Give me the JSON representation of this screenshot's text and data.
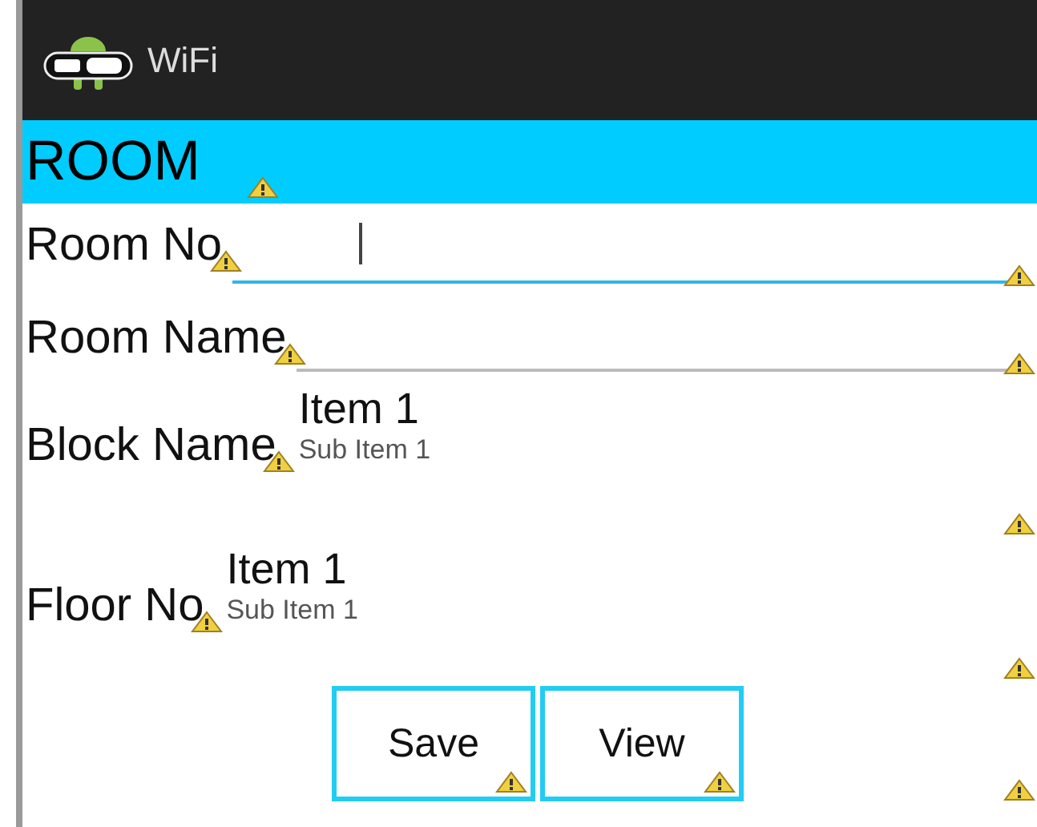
{
  "action_bar": {
    "title": "WiFi"
  },
  "header": "ROOM",
  "fields": [
    {
      "kind": "input",
      "label": "Room No",
      "focused": true
    },
    {
      "kind": "input",
      "label": "Room Name",
      "focused": false
    },
    {
      "kind": "spinner",
      "label": "Block Name",
      "item": "Item 1",
      "sub_item": "Sub Item 1"
    },
    {
      "kind": "spinner",
      "label": "Floor No",
      "item": "Item 1",
      "sub_item": "Sub Item 1"
    }
  ],
  "buttons": [
    "Save",
    "View"
  ]
}
